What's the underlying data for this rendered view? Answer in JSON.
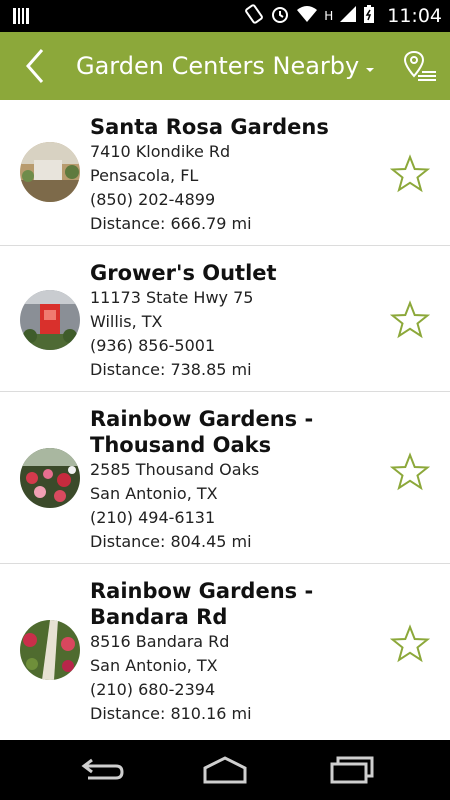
{
  "status_bar": {
    "time": "11:04",
    "network_label": "H"
  },
  "action_bar": {
    "title": "Garden Centers Nearby"
  },
  "stores": [
    {
      "name": "Santa Rosa Gardens",
      "address": "7410 Klondike Rd",
      "city": "Pensacola, FL",
      "phone": "(850) 202-4899",
      "distance": "Distance: 666.79 mi"
    },
    {
      "name": "Grower's Outlet",
      "address": "11173 State Hwy 75",
      "city": "Willis, TX",
      "phone": "(936) 856-5001",
      "distance": "Distance: 738.85 mi"
    },
    {
      "name": "Rainbow Gardens - Thousand Oaks",
      "address": "2585 Thousand Oaks",
      "city": "San Antonio, TX",
      "phone": "(210) 494-6131",
      "distance": "Distance: 804.45 mi"
    },
    {
      "name": "Rainbow Gardens - Bandara Rd",
      "address": "8516 Bandara Rd",
      "city": "San Antonio, TX",
      "phone": "(210) 680-2394",
      "distance": "Distance: 810.16 mi"
    }
  ],
  "colors": {
    "action_bar": "#8ca83a",
    "star_outline": "#8ca83a"
  }
}
